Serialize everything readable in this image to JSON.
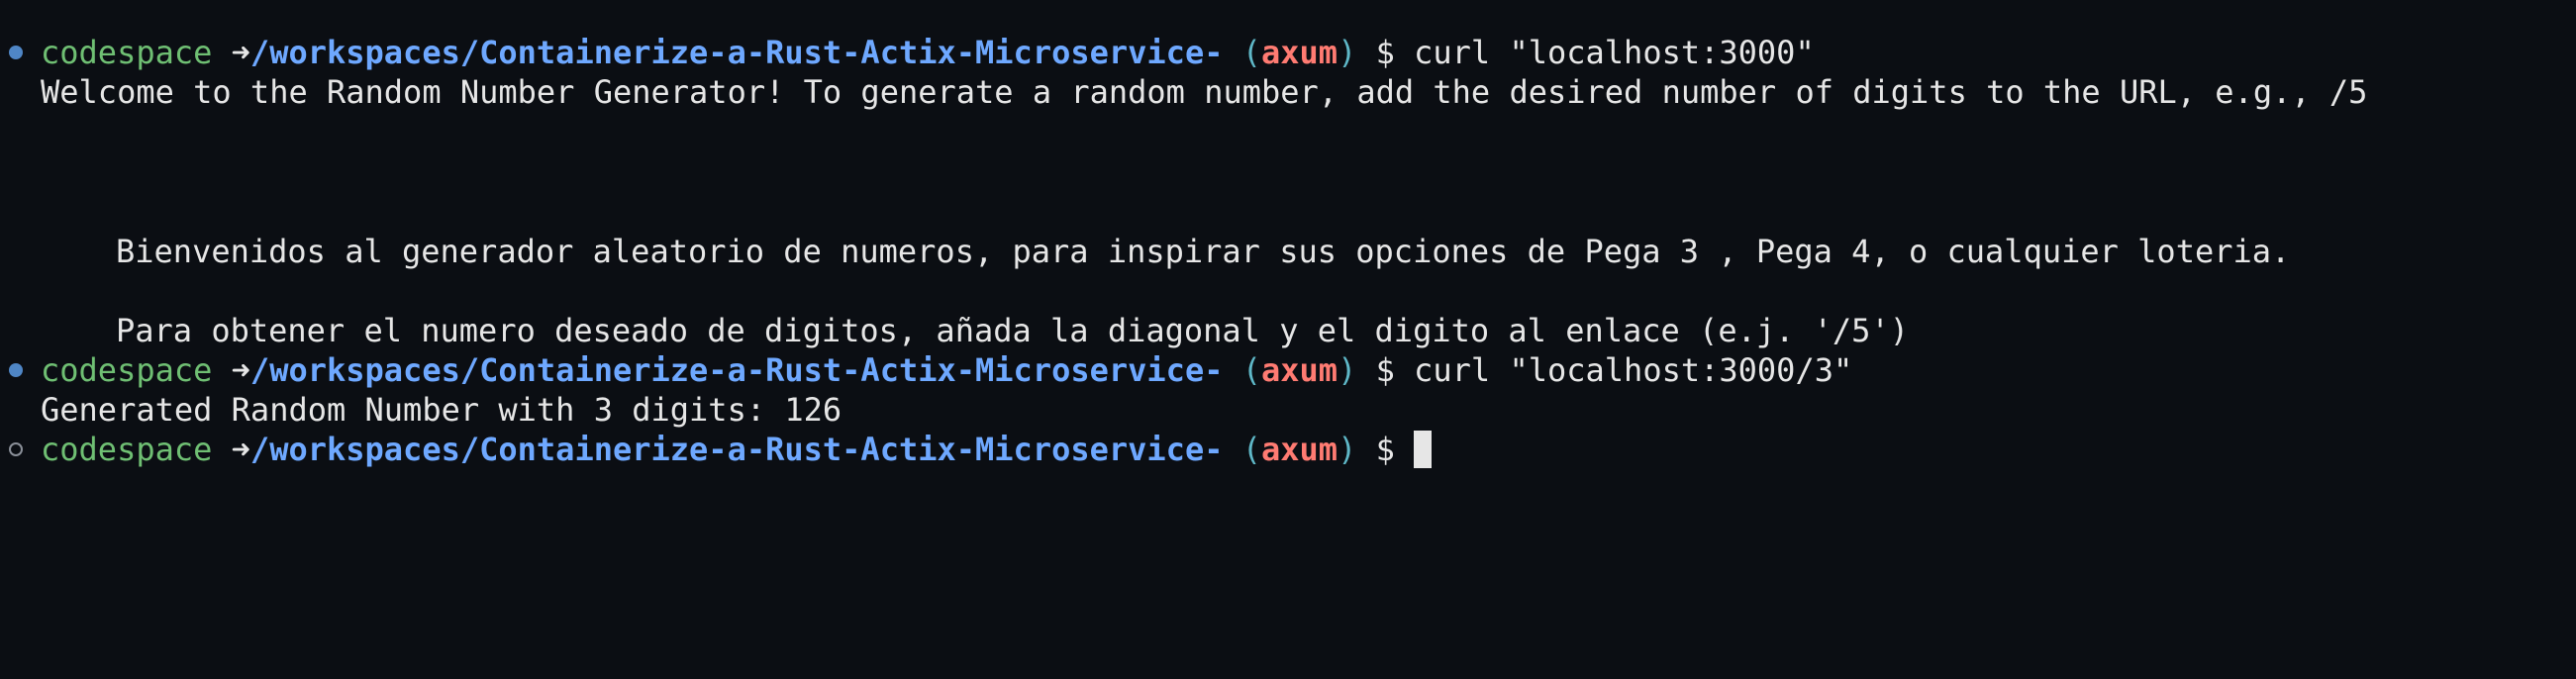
{
  "colors": {
    "background": "#0b0e13",
    "foreground": "#e6e6e6",
    "host": "#6fbf73",
    "path": "#6ea8ff",
    "branch": "#ff7b72",
    "paren": "#5fb8c8",
    "marker_success": "#4f86c6"
  },
  "prompt": {
    "host": "codespace",
    "arrow": "➜",
    "path": "/workspaces/Containerize-a-Rust-Actix-Microservice-",
    "open_paren": "(",
    "branch": "axum",
    "close_paren": ")",
    "symbol": "$"
  },
  "entries": [
    {
      "command": "curl \"localhost:3000\"",
      "output": [
        "Welcome to the Random Number Generator! To generate a random number, add the desired number of digits to the URL, e.g., /5",
        "Bienvenidos al generador aleatorio de numeros, para inspirar sus opciones de Pega 3 , Pega 4, o cualquier loteria.",
        "Para obtener el numero deseado de digitos, añada la diagonal y el digito al enlace (e.j. '/5')"
      ]
    },
    {
      "command": "curl \"localhost:3000/3\"",
      "output": [
        "Generated Random Number with 3 digits: 126"
      ]
    }
  ]
}
